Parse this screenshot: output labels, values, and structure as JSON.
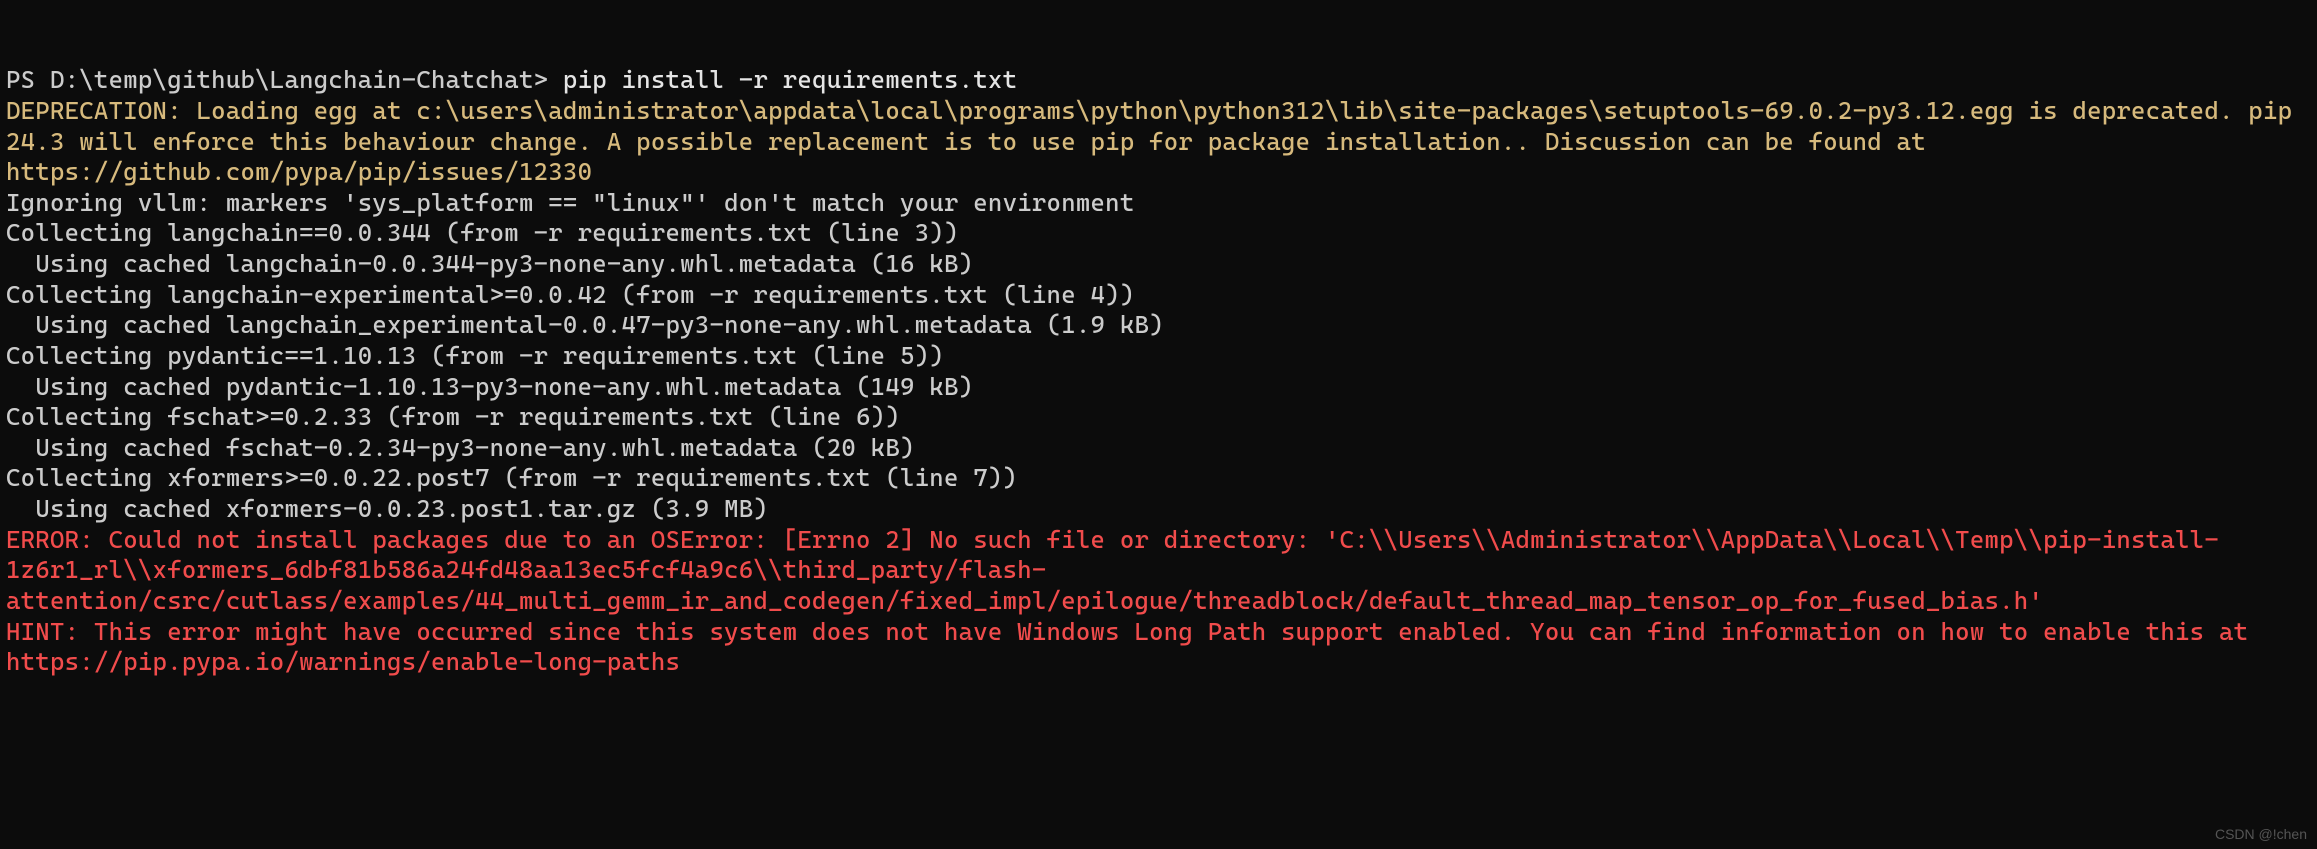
{
  "prompt": {
    "prefix": "PS D:\\temp\\github\\Langchain-Chatchat> ",
    "command": "pip install -r requirements.txt"
  },
  "deprecation": "DEPRECATION: Loading egg at c:\\users\\administrator\\appdata\\local\\programs\\python\\python312\\lib\\site-packages\\setuptools-69.0.2-py3.12.egg is deprecated. pip 24.3 will enforce this behaviour change. A possible replacement is to use pip for package installation.. Discussion can be found at https://github.com/pypa/pip/issues/12330",
  "collect_lines": [
    "Ignoring vllm: markers 'sys_platform == \"linux\"' don't match your environment",
    "Collecting langchain==0.0.344 (from -r requirements.txt (line 3))",
    "  Using cached langchain-0.0.344-py3-none-any.whl.metadata (16 kB)",
    "Collecting langchain-experimental>=0.0.42 (from -r requirements.txt (line 4))",
    "  Using cached langchain_experimental-0.0.47-py3-none-any.whl.metadata (1.9 kB)",
    "Collecting pydantic==1.10.13 (from -r requirements.txt (line 5))",
    "  Using cached pydantic-1.10.13-py3-none-any.whl.metadata (149 kB)",
    "Collecting fschat>=0.2.33 (from -r requirements.txt (line 6))",
    "  Using cached fschat-0.2.34-py3-none-any.whl.metadata (20 kB)",
    "Collecting xformers>=0.0.22.post7 (from -r requirements.txt (line 7))",
    "  Using cached xformers-0.0.23.post1.tar.gz (3.9 MB)"
  ],
  "error": "ERROR: Could not install packages due to an OSError: [Errno 2] No such file or directory: 'C:\\\\Users\\\\Administrator\\\\AppData\\\\Local\\\\Temp\\\\pip-install-1z6r1_rl\\\\xformers_6dbf81b586a24fd48aa13ec5fcf4a9c6\\\\third_party/flash-attention/csrc/cutlass/examples/44_multi_gemm_ir_and_codegen/fixed_impl/epilogue/threadblock/default_thread_map_tensor_op_for_fused_bias.h'",
  "blank": "",
  "hint": "HINT: This error might have occurred since this system does not have Windows Long Path support enabled. You can find information on how to enable this at https://pip.pypa.io/warnings/enable-long-paths",
  "watermark": "CSDN @!chen"
}
